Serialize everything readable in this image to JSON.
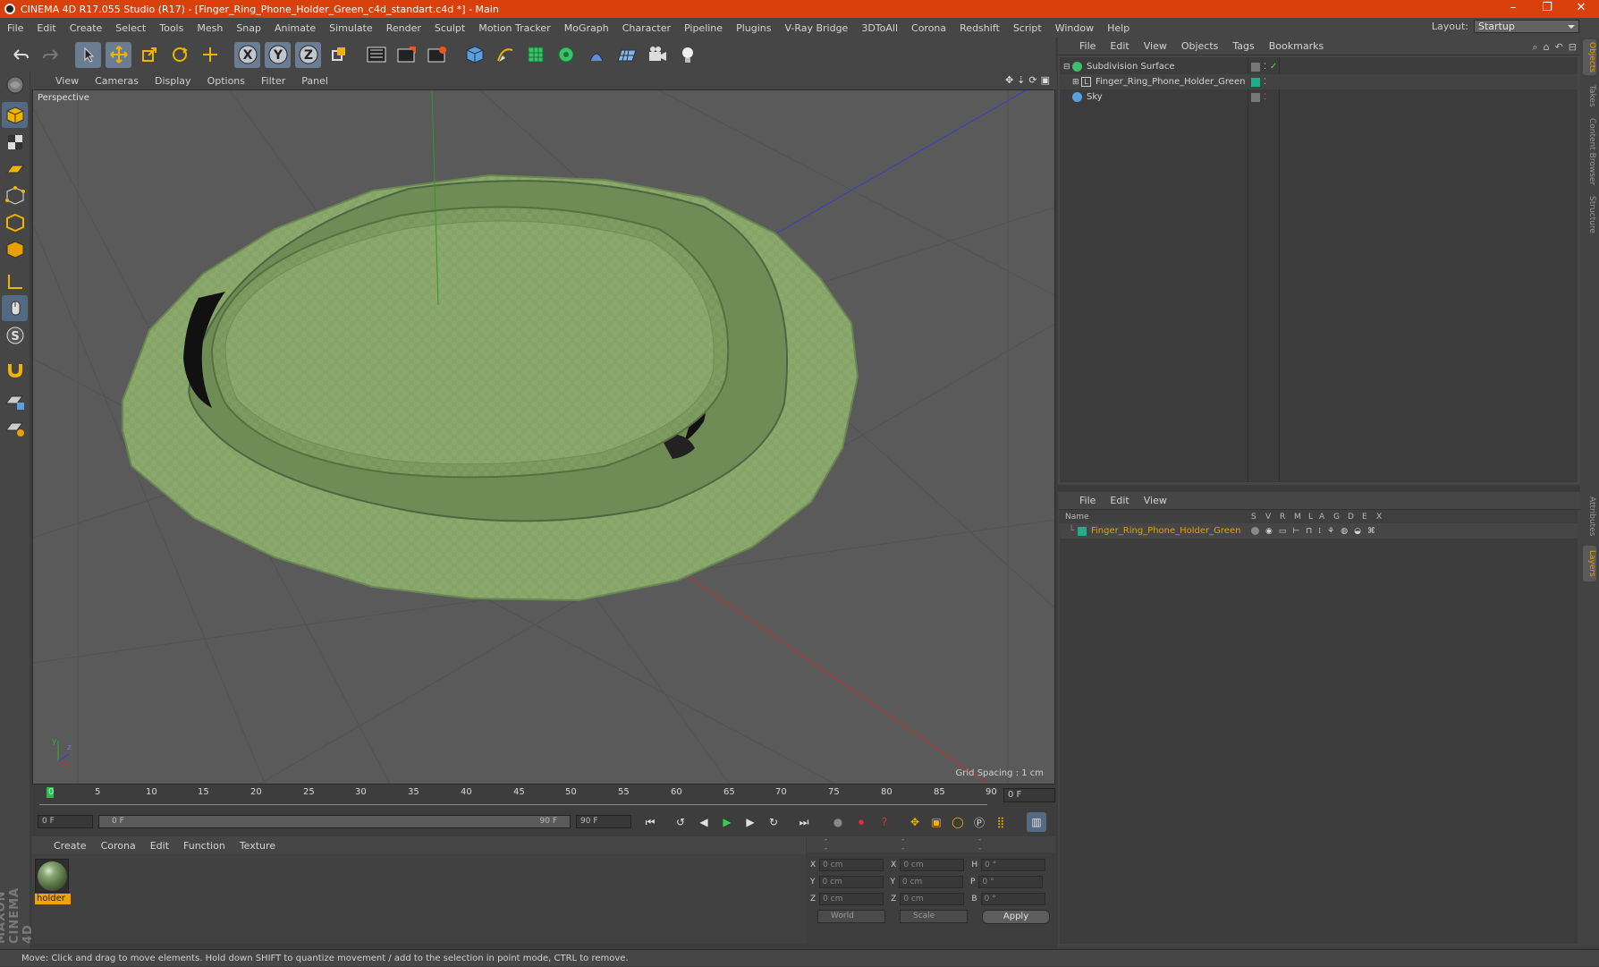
{
  "window": {
    "title": "CINEMA 4D R17.055 Studio (R17) - [Finger_Ring_Phone_Holder_Green_c4d_standart.c4d *] - Main",
    "minimize": "–",
    "maximize": "❐",
    "close": "✕"
  },
  "menu": [
    "File",
    "Edit",
    "Create",
    "Select",
    "Tools",
    "Mesh",
    "Snap",
    "Animate",
    "Simulate",
    "Render",
    "Sculpt",
    "Motion Tracker",
    "MoGraph",
    "Character",
    "Pipeline",
    "Plugins",
    "V-Ray Bridge",
    "3DToAll",
    "Corona",
    "Redshift",
    "Script",
    "Window",
    "Help"
  ],
  "layout": {
    "label": "Layout:",
    "value": "Startup"
  },
  "toolbar": {
    "x_axis": "X",
    "y_axis": "Y",
    "z_axis": "Z"
  },
  "viewport": {
    "menu": [
      "View",
      "Cameras",
      "Display",
      "Options",
      "Filter",
      "Panel"
    ],
    "label": "Perspective",
    "grid_spacing": "Grid Spacing : 1 cm",
    "axis_y": "y",
    "axis_z": "z"
  },
  "timeline": {
    "ticks": [
      "0",
      "5",
      "10",
      "15",
      "20",
      "25",
      "30",
      "35",
      "40",
      "45",
      "50",
      "55",
      "60",
      "65",
      "70",
      "75",
      "80",
      "85",
      "90"
    ],
    "current_frame": "0 F",
    "start_field": "0 F",
    "range_start": "0 F",
    "range_end": "90 F",
    "end_field": "90 F"
  },
  "material_panel": {
    "menu": [
      "Create",
      "Corona",
      "Edit",
      "Function",
      "Texture"
    ],
    "material_name": "holder"
  },
  "coordinates": {
    "header": [
      "--",
      "--",
      "--"
    ],
    "rows": [
      {
        "a": "X",
        "av": "0 cm",
        "b": "X",
        "bv": "0 cm",
        "c": "H",
        "cv": "0 °"
      },
      {
        "a": "Y",
        "av": "0 cm",
        "b": "Y",
        "bv": "0 cm",
        "c": "P",
        "cv": "0 °"
      },
      {
        "a": "Z",
        "av": "0 cm",
        "b": "Z",
        "bv": "0 cm",
        "c": "B",
        "cv": "0 °"
      }
    ],
    "world": "World",
    "scale": "Scale",
    "apply": "Apply"
  },
  "objects_panel": {
    "menu": [
      "File",
      "Edit",
      "View",
      "Objects",
      "Tags",
      "Bookmarks"
    ],
    "items": [
      {
        "name": "Subdivision Surface",
        "color": "#c8c8c8"
      },
      {
        "name": "Finger_Ring_Phone_Holder_Green",
        "color": "#c8c8c8"
      },
      {
        "name": "Sky",
        "color": "#c8c8c8"
      }
    ]
  },
  "layers_panel": {
    "menu": [
      "File",
      "Edit",
      "View"
    ],
    "columns": [
      "Name",
      "S",
      "V",
      "R",
      "M",
      "L",
      "A",
      "G",
      "D",
      "E",
      "X"
    ],
    "layer_name": "Finger_Ring_Phone_Holder_Green",
    "layer_color": "#e8a000"
  },
  "side_tabs": [
    "Objects",
    "Takes",
    "Content Browser",
    "Structure",
    "Attributes",
    "Layers"
  ],
  "logo": "MAXON CINEMA 4D",
  "status": "Move: Click and drag to move elements. Hold down SHIFT to quantize movement / add to the selection in point mode, CTRL to remove.",
  "colors": {
    "accent": "#d9400c",
    "layer": "#e8a000",
    "object_green": "#8ba86d"
  }
}
